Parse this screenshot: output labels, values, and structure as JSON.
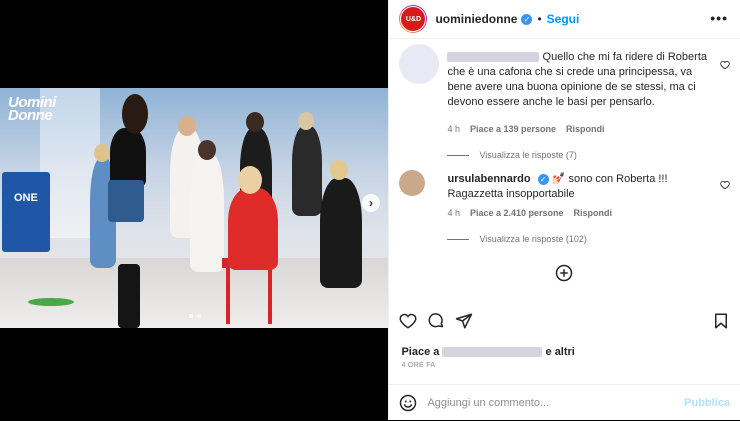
{
  "post": {
    "username": "uominiedonne",
    "avatar_text": "U&D",
    "separator": "•",
    "follow_label": "Segui",
    "more_label": "•••",
    "photo_logo_line1": "Uomini",
    "photo_logo_line2": "Donne",
    "photo_podium_text": "ONE"
  },
  "comments": [
    {
      "username": "",
      "text": "Quello che mi fa ridere di Roberta che è una cafona che si crede una principessa, va bene avere una buona opinione de se stessi, ma ci devono essere anche le basi per pensarlo.",
      "time": "4 h",
      "likes": "Piace a 139 persone",
      "reply_label": "Rispondi",
      "view_replies": "Visualizza le risposte (7)",
      "avatar_color": "#e9e8f5"
    },
    {
      "username": "ursulabennardo",
      "text": "💅🏻 sono con Roberta !!! Ragazzetta insopportabile",
      "time": "4 h",
      "likes": "Piace a 2.410 persone",
      "reply_label": "Rispondi",
      "view_replies": "Visualizza le risposte (102)",
      "avatar_color": "#c9a98a"
    }
  ],
  "likes_prefix": "Piace a",
  "likes_suffix": "e altri",
  "timestamp": "4 ORE FA",
  "composer": {
    "placeholder": "Aggiungi un commento...",
    "publish_label": "Pubblica"
  },
  "icons": [
    "heart-icon",
    "comment-icon",
    "share-icon",
    "bookmark-icon",
    "emoji-icon",
    "add-circle-icon",
    "verified-icon",
    "next-arrow-icon"
  ],
  "colors": {
    "follow": "#0095f6",
    "verified": "#3897f0",
    "publish": "#b2dffc",
    "brand_red": "#d71a1a"
  }
}
